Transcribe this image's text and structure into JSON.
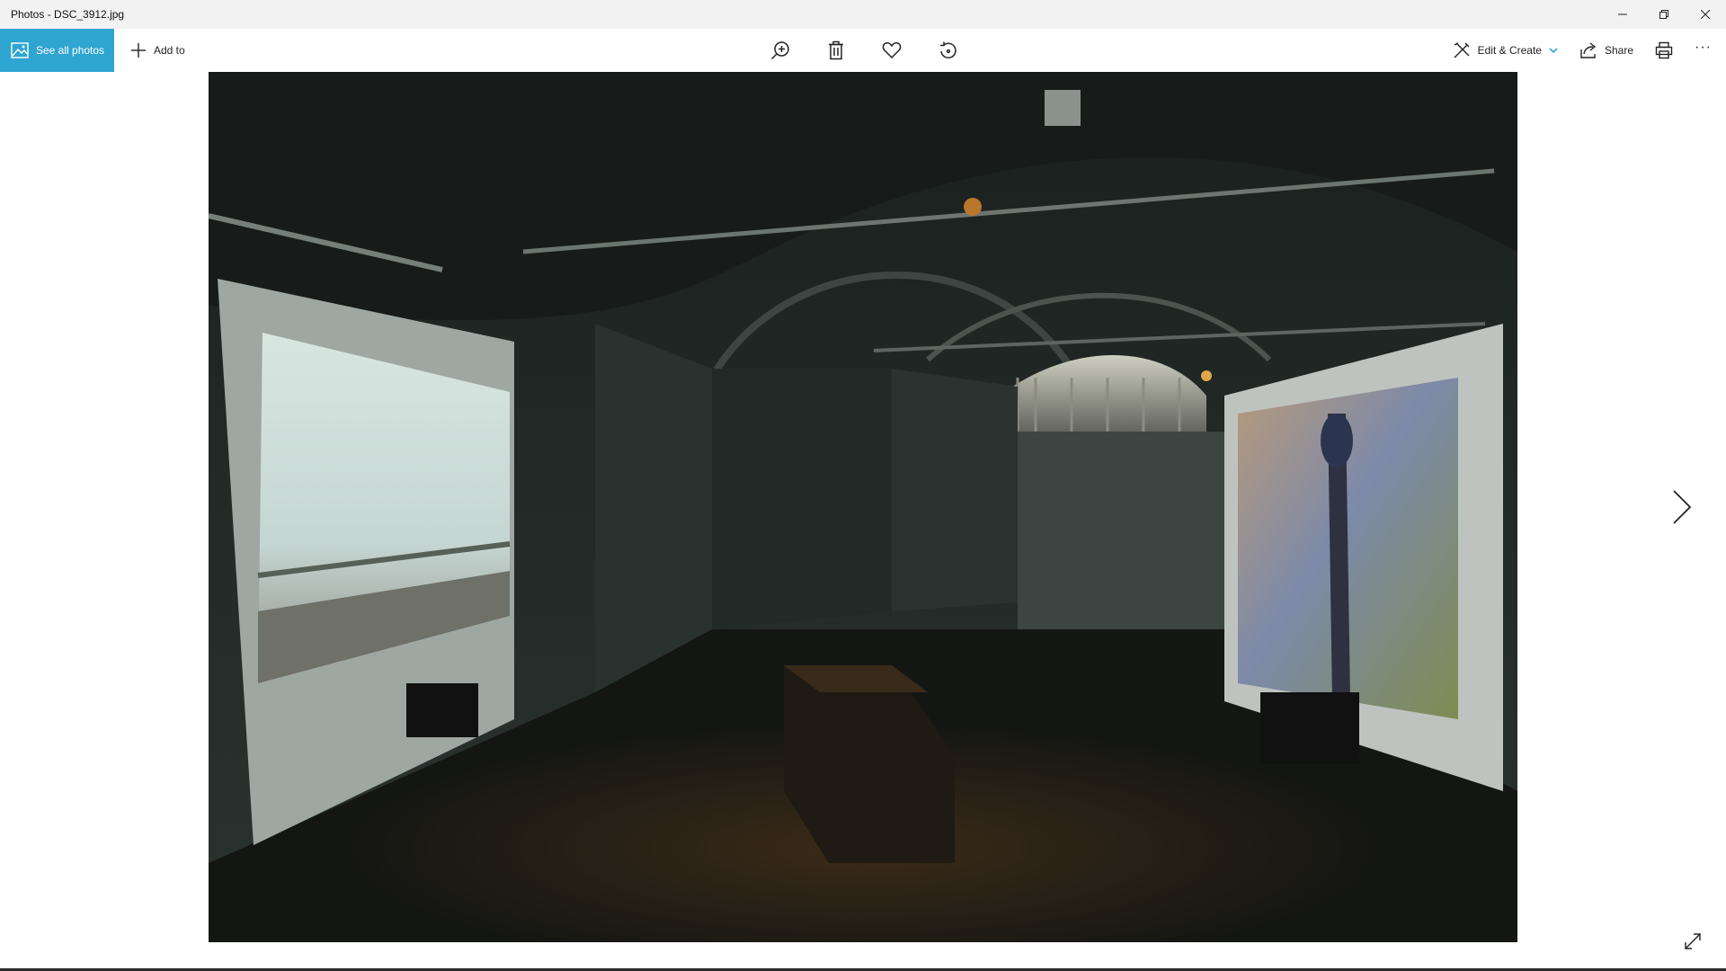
{
  "window": {
    "title": "Photos - DSC_3912.jpg"
  },
  "caption": {
    "minimize_icon": "minimize-icon",
    "restore_icon": "restore-icon",
    "close_icon": "close-icon"
  },
  "toolbar": {
    "see_all_label": "See all photos",
    "add_to_label": "Add to",
    "zoom_icon": "zoom-in-icon",
    "delete_icon": "delete-icon",
    "favorite_icon": "heart-icon",
    "rotate_icon": "rotate-icon",
    "edit_create_label": "Edit & Create",
    "share_label": "Share",
    "print_icon": "print-icon",
    "more_label": "···"
  },
  "viewer": {
    "next_icon": "chevron-right-icon",
    "fullscreen_icon": "expand-icon"
  },
  "colors": {
    "accent": "#2fa5d1",
    "titlebar_bg": "#f2f2f2",
    "canvas_bg": "#ffffff"
  }
}
